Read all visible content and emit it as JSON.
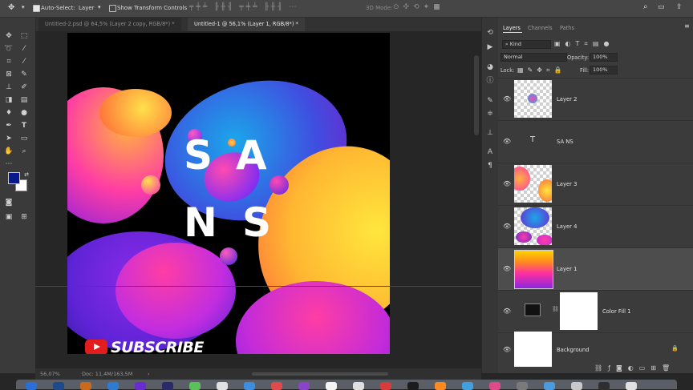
{
  "options_bar": {
    "move_icon": "move-icon",
    "auto_select_label": "Auto-Select:",
    "auto_select_checked": true,
    "auto_select_target": "Layer",
    "transform_controls_label": "Show Transform Controls",
    "transform_controls_checked": false,
    "mode_3d_label": "3D Mode:"
  },
  "tabs": [
    {
      "label": "Untitled-2.psd @ 64,5% (Layer 2 copy, RGB/8*) *",
      "active": false
    },
    {
      "label": "Untitled-1 @ 56,1% (Layer 1, RGB/8*) *",
      "active": true
    }
  ],
  "canvas": {
    "letters": [
      "S",
      "A",
      "N",
      "S"
    ],
    "subscribe_text": "SUBSCRIBE"
  },
  "status": {
    "zoom": "56,07%",
    "doc_size": "Doc: 11,4M/163,5M"
  },
  "panel": {
    "tabs": [
      "Layers",
      "Channels",
      "Paths"
    ],
    "active_tab": "Layers",
    "filter_kind": "Kind",
    "blend_mode": "Normal",
    "opacity_label": "Opacity:",
    "opacity_value": "100%",
    "lock_label": "Lock:",
    "fill_label": "Fill:",
    "fill_value": "100%",
    "layers": [
      {
        "name": "Layer 2",
        "type": "pixel",
        "visible": true,
        "selected": false
      },
      {
        "name": "SA NS",
        "type": "text",
        "visible": true,
        "selected": false
      },
      {
        "name": "Layer 3",
        "type": "pixel",
        "visible": true,
        "selected": false
      },
      {
        "name": "Layer 4",
        "type": "pixel",
        "visible": true,
        "selected": false
      },
      {
        "name": "Layer 1",
        "type": "pixel",
        "visible": true,
        "selected": true
      },
      {
        "name": "Color Fill 1",
        "type": "fill",
        "visible": true,
        "selected": false
      },
      {
        "name": "Background",
        "type": "background",
        "visible": true,
        "selected": false,
        "locked": true
      }
    ]
  },
  "colors": {
    "foreground": "#0a1a8c",
    "background": "#ffffff",
    "accent_gradient": [
      "#ff2fa0",
      "#7b2cf5",
      "#12a6e8",
      "#ffd400"
    ]
  }
}
